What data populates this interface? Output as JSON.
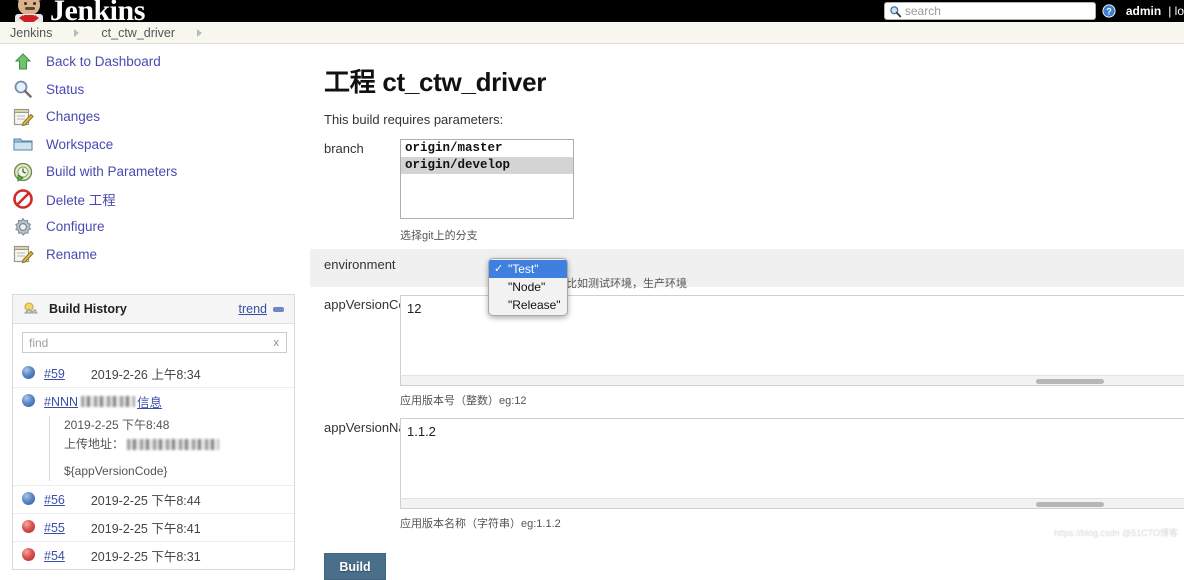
{
  "header": {
    "brand": "Jenkins",
    "brand_icon": "jenkins-butler-icon",
    "search_placeholder": "search",
    "search_value": "",
    "search_icon": "search-icon",
    "help_icon": "help-circle-icon",
    "user": "admin",
    "logout": "| lo"
  },
  "breadcrumb": {
    "items": [
      {
        "label": "Jenkins"
      },
      {
        "label": "ct_ctw_driver"
      }
    ]
  },
  "sidebar": {
    "items": [
      {
        "label": "Back to Dashboard",
        "icon": "up-arrow-icon"
      },
      {
        "label": "Status",
        "icon": "magnifier-icon"
      },
      {
        "label": "Changes",
        "icon": "notepad-pencil-icon"
      },
      {
        "label": "Workspace",
        "icon": "folder-icon"
      },
      {
        "label": "Build with Parameters",
        "icon": "clock-play-icon"
      },
      {
        "label": "Delete 工程",
        "icon": "no-entry-icon"
      },
      {
        "label": "Configure",
        "icon": "gear-icon"
      },
      {
        "label": "Rename",
        "icon": "notepad-pencil-icon"
      }
    ]
  },
  "build_history": {
    "title": "Build History",
    "icon": "build-history-icon",
    "trend_label": "trend",
    "trend_icon": "trend-bar-icon",
    "find_placeholder": "find",
    "find_value": "",
    "clear_label": "x",
    "rows": [
      {
        "number": "#59",
        "status": "blue",
        "date": "2019-2-26 上午8:34",
        "expanded": false
      },
      {
        "number": "#NNN",
        "status": "blue",
        "title_suffix_redacted": true,
        "title_tail": "信息",
        "expanded": true,
        "date": "2019-2-25 下午8:48",
        "upload_label": "上传地址：",
        "upload_value_redacted": true,
        "var_text": "${appVersionCode}"
      },
      {
        "number": "#56",
        "status": "blue",
        "date": "2019-2-25 下午8:44",
        "expanded": false
      },
      {
        "number": "#55",
        "status": "red",
        "date": "2019-2-25 下午8:41",
        "expanded": false
      },
      {
        "number": "#54",
        "status": "red",
        "date": "2019-2-25 下午8:31",
        "expanded": false
      }
    ]
  },
  "main": {
    "title": "工程 ct_ctw_driver",
    "requires_note": "This build requires parameters:",
    "build_button": "Build",
    "params": {
      "branch": {
        "label": "branch",
        "options": [
          {
            "value": "origin/master",
            "selected": false
          },
          {
            "value": "origin/develop",
            "selected": true
          }
        ],
        "hint": "选择git上的分支"
      },
      "environment": {
        "label": "environment",
        "hint": "比如测试环境，生产环境",
        "selected": "\"Test\"",
        "options": [
          {
            "value": "\"Test\"",
            "selected": true
          },
          {
            "value": "\"Node\"",
            "selected": false
          },
          {
            "value": "\"Release\"",
            "selected": false
          }
        ]
      },
      "appVersionCode": {
        "label": "appVersionCode",
        "value": "12",
        "hint": "应用版本号（整数）eg:12"
      },
      "appVersionName": {
        "label": "appVersionName",
        "value": "1.1.2",
        "hint": "应用版本名称（字符串）eg:1.1.2"
      }
    }
  },
  "watermark": "https://blog.csdn @51CTO博客",
  "colors": {
    "header_bg": "#000000",
    "breadcrumb_bg": "#f7f7f0",
    "link": "#4a4ab0",
    "build_button_bg": "#4a6f8a",
    "select_highlight": "#3f7fe0",
    "status_blue": "#5b87c4",
    "status_red": "#d9534f"
  }
}
